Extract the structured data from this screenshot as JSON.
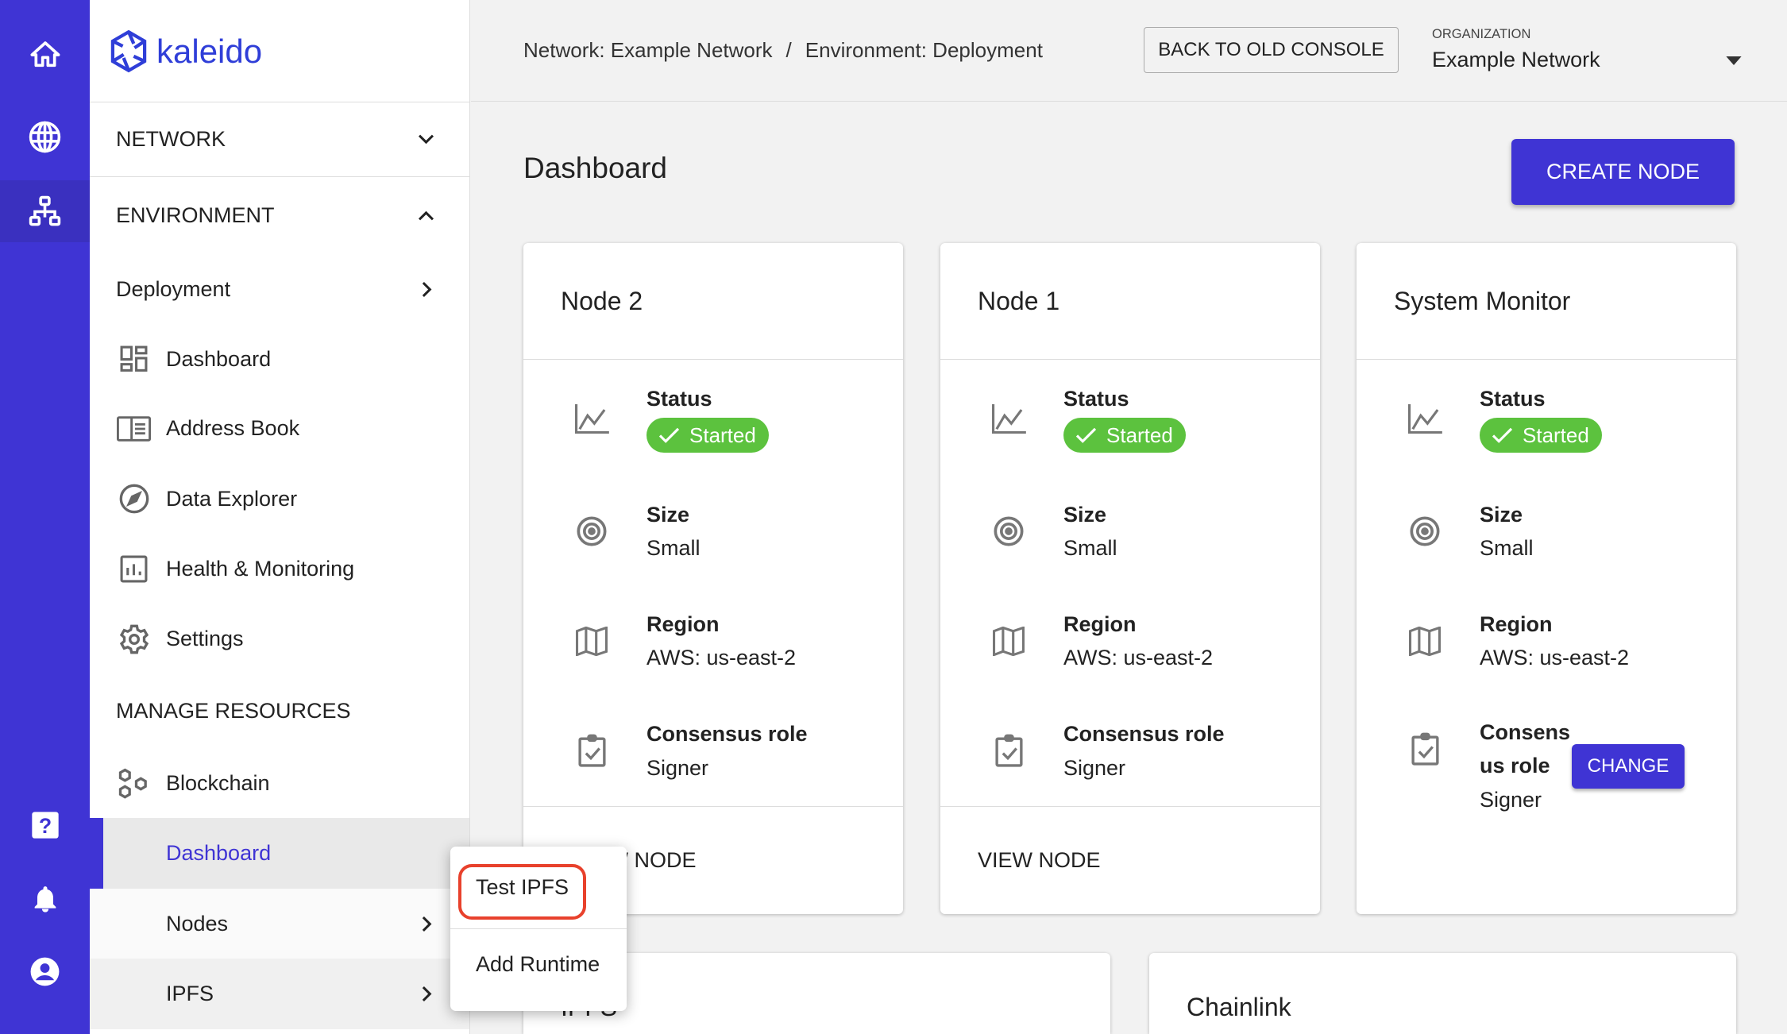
{
  "rail": {
    "items": [
      {
        "icon": "home-icon"
      },
      {
        "icon": "globe-icon"
      },
      {
        "icon": "network-icon",
        "active": true
      },
      {
        "icon": "help-icon"
      },
      {
        "icon": "bell-icon"
      },
      {
        "icon": "account-circle-icon"
      }
    ],
    "color": "#3f34d4"
  },
  "sidebar": {
    "logo_text": "kaleido",
    "network_label": "NETWORK",
    "environment_label": "ENVIRONMENT",
    "environment_name": "Deployment",
    "items": [
      {
        "label": "Dashboard",
        "icon": "dashboard-icon"
      },
      {
        "label": "Address Book",
        "icon": "address-book-icon"
      },
      {
        "label": "Data Explorer",
        "icon": "compass-icon"
      },
      {
        "label": "Health & Monitoring",
        "icon": "bar-chart-icon"
      },
      {
        "label": "Settings",
        "icon": "gear-icon"
      }
    ],
    "manage_label": "MANAGE RESOURCES",
    "blockchain_label": "Blockchain",
    "sub_items": [
      {
        "label": "Dashboard",
        "active": true
      },
      {
        "label": "Nodes"
      },
      {
        "label": "IPFS"
      }
    ]
  },
  "header": {
    "breadcrumb": [
      "Network: Example Network",
      "Environment: Deployment"
    ],
    "separator": "/",
    "back_button": "BACK TO OLD CONSOLE",
    "org_label": "ORGANIZATION",
    "org_value": "Example Network"
  },
  "main": {
    "title": "Dashboard",
    "create_button": "CREATE NODE",
    "accent": "#3f34d4",
    "cards": [
      {
        "title": "Node 2",
        "status_label": "Status",
        "status": "Started",
        "size_label": "Size",
        "size": "Small",
        "region_label": "Region",
        "region": "AWS: us-east-2",
        "role_label": "Consensus role",
        "role": "Signer",
        "action": "VIEW NODE"
      },
      {
        "title": "Node 1",
        "status_label": "Status",
        "status": "Started",
        "size_label": "Size",
        "size": "Small",
        "region_label": "Region",
        "region": "AWS: us-east-2",
        "role_label": "Consensus role",
        "role": "Signer",
        "action": "VIEW NODE"
      },
      {
        "title": "System Monitor",
        "status_label": "Status",
        "status": "Started",
        "size_label": "Size",
        "size": "Small",
        "region_label": "Region",
        "region": "AWS: us-east-2",
        "role_label_1": "Consens",
        "role_label_2": "us role",
        "role": "Signer",
        "change_button": "CHANGE"
      }
    ],
    "status_color": "#5cc23e",
    "bottom_cards": [
      {
        "title": "IPFS"
      },
      {
        "title": "Chainlink"
      }
    ]
  },
  "popup_menu": {
    "items": [
      {
        "label": "Test IPFS",
        "highlighted": true
      },
      {
        "label": "Add Runtime"
      }
    ],
    "highlight_color": "#e8412c"
  }
}
